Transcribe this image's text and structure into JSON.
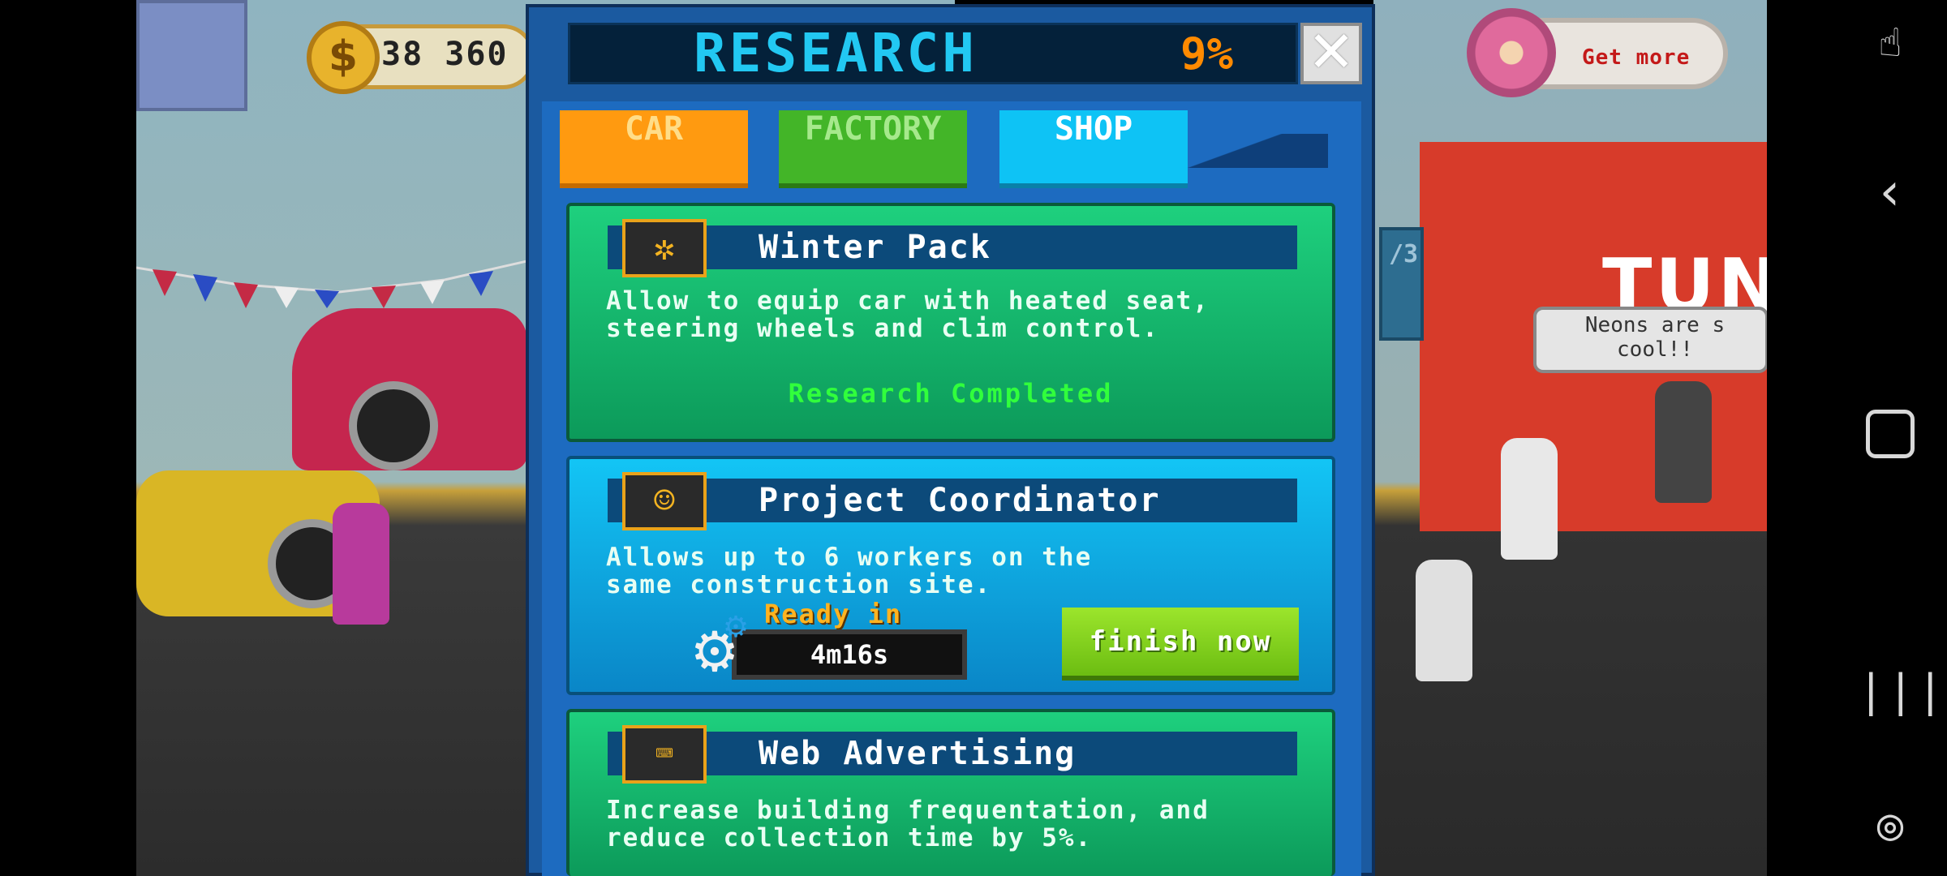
{
  "hud": {
    "coins": "38 360",
    "get_more_label": "Get more"
  },
  "scene": {
    "speech_bubble": "Neons are s cool!!",
    "shop_sign": "TUN",
    "counter_label": "/3"
  },
  "research": {
    "title": "RESEARCH",
    "percent": "9%",
    "close_symbol": "✕",
    "tabs": [
      {
        "label": "CAR"
      },
      {
        "label": "FACTORY"
      },
      {
        "label": "SHOP"
      }
    ],
    "active_tab": "SHOP",
    "items": [
      {
        "title": "Winter Pack",
        "icon": "snowflake-icon",
        "description": "Allow to equip car with heated seat,\nsteering wheels and clim control.",
        "status": "Research Completed"
      },
      {
        "title": "Project Coordinator",
        "icon": "coordinator-icon",
        "description": "Allows  up to 6 workers on the\nsame construction site.",
        "ready_label": "Ready in",
        "timer": "4m16s",
        "finish_label": "finish now"
      },
      {
        "title": "Web Advertising",
        "icon": "web-ad-icon",
        "description": "Increase building frequentation, and\nreduce collection time by 5%."
      }
    ]
  },
  "colors": {
    "title_cyan": "#22c8f2",
    "percent_orange": "#ff8a00",
    "tab_car": "#ff9a10",
    "tab_factory": "#43b528",
    "tab_shop": "#0ec3f5",
    "completed_green": "#31ff3c",
    "finish_green": "#8fdc24"
  }
}
